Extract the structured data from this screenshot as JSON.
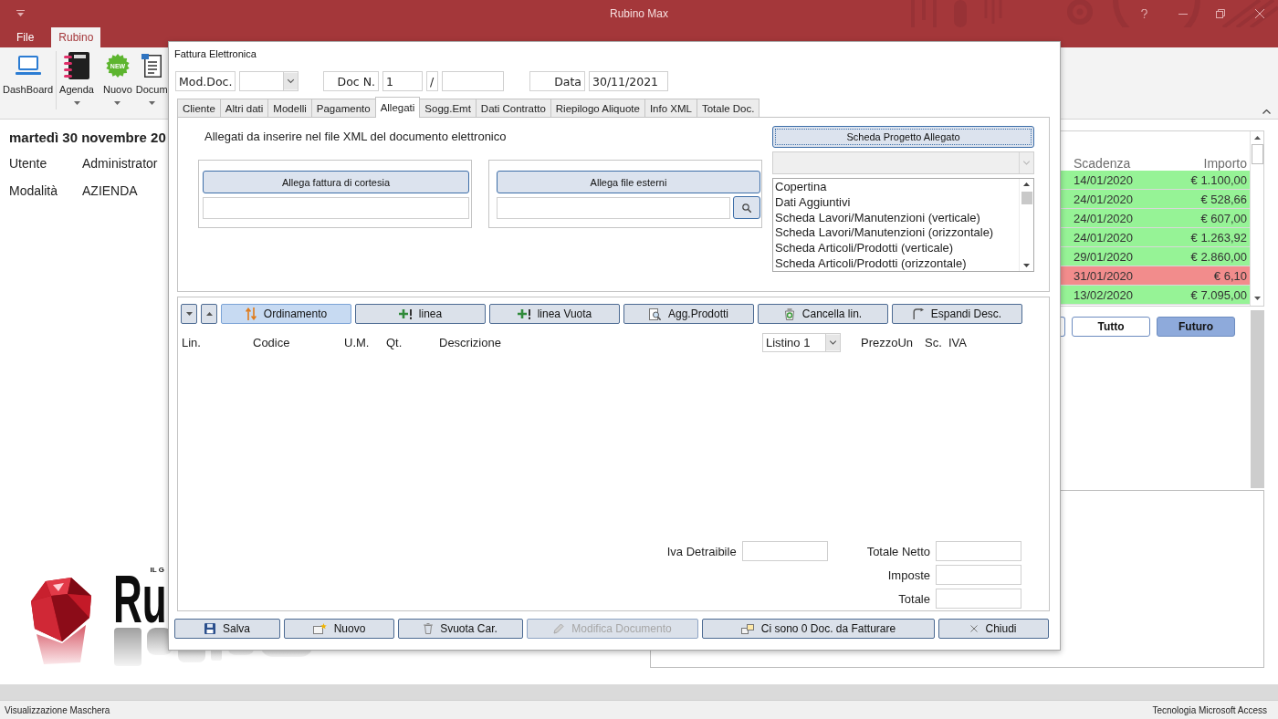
{
  "window": {
    "title": "Rubino Max"
  },
  "ribbon": {
    "tabs": [
      {
        "label": "File",
        "selected": false
      },
      {
        "label": "Rubino",
        "selected": true
      }
    ],
    "buttons": [
      {
        "label": "DashBoard",
        "dropdown": false
      },
      {
        "label": "Agenda",
        "dropdown": true
      },
      {
        "label": "Nuovo",
        "dropdown": true,
        "badge": "NEW"
      },
      {
        "label": "Docum",
        "dropdown": true
      }
    ]
  },
  "session": {
    "date": "martedì 30 novembre 20",
    "fields": [
      {
        "label": "Utente",
        "value": "Administrator"
      },
      {
        "label": "Modalità",
        "value": "AZIENDA"
      }
    ]
  },
  "logo": {
    "tagline": "IL G",
    "wordmark": "Ru"
  },
  "deadlines": {
    "columns": [
      "Scadenza",
      "Importo"
    ],
    "rows": [
      {
        "date": "14/01/2020",
        "amount": "€ 1.100,00",
        "color": "#96f396"
      },
      {
        "date": "24/01/2020",
        "amount": "€ 528,66",
        "color": "#96f396"
      },
      {
        "date": "24/01/2020",
        "amount": "€ 607,00",
        "color": "#96f396"
      },
      {
        "date": "24/01/2020",
        "amount": "€ 1.263,92",
        "color": "#96f396"
      },
      {
        "date": "29/01/2020",
        "amount": "€ 2.860,00",
        "color": "#96f396"
      },
      {
        "date": "31/01/2020",
        "amount": "€ 6,10",
        "color": "#f28c8c"
      },
      {
        "date": "13/02/2020",
        "amount": "€ 7.095,00",
        "color": "#96f396"
      }
    ],
    "filters": [
      {
        "selected": false
      },
      {
        "label": "Tutto",
        "selected": false
      },
      {
        "label": "Futuro",
        "selected": true
      }
    ]
  },
  "dialog": {
    "title": "Fattura Elettronica",
    "header": {
      "model_label": "Mod.Doc.",
      "number_label": "Doc N.",
      "number": "1",
      "separator": "/",
      "date_label": "Data",
      "date": "30/11/2021"
    },
    "tabs": [
      {
        "label": "Cliente",
        "selected": false
      },
      {
        "label": "Altri dati",
        "selected": false
      },
      {
        "label": "Modelli",
        "selected": false
      },
      {
        "label": "Pagamento",
        "selected": false
      },
      {
        "label": "Allegati",
        "selected": true
      },
      {
        "label": "Sogg.Emt",
        "selected": false
      },
      {
        "label": "Dati Contratto",
        "selected": false
      },
      {
        "label": "Riepilogo Aliquote",
        "selected": false
      },
      {
        "label": "Info XML",
        "selected": false
      },
      {
        "label": "Totale Doc.",
        "selected": false
      }
    ],
    "attachments": {
      "caption": "Allegati da inserire nel file XML del documento elettronico",
      "courtesy_button": "Allega fattura di cortesia",
      "external_button": "Allega file esterni",
      "project_button": "Scheda Progetto Allegato",
      "template_select": {
        "disabled": true
      },
      "templates": [
        "Copertina",
        "Dati Aggiuntivi",
        "Scheda Lavori/Manutenzioni (verticale)",
        "Scheda Lavori/Manutenzioni (orizzontale)",
        "Scheda Articoli/Prodotti (verticale)",
        "Scheda Articoli/Prodotti (orizzontale)"
      ]
    },
    "lines": {
      "toolbar": [
        {
          "label": "Ordinamento",
          "selected": true
        },
        {
          "label": "linea",
          "selected": false
        },
        {
          "label": "linea Vuota",
          "selected": false
        },
        {
          "label": "Agg.Prodotti",
          "selected": false
        },
        {
          "label": "Cancella lin.",
          "selected": false
        },
        {
          "label": "Espandi Desc.",
          "selected": false
        }
      ],
      "columns": [
        {
          "kind": "label",
          "text": "Lin."
        },
        {
          "kind": "label",
          "text": "Codice"
        },
        {
          "kind": "label",
          "text": "U.M."
        },
        {
          "kind": "label",
          "text": "Qt."
        },
        {
          "kind": "label",
          "text": "Descrizione"
        },
        {
          "kind": "combo",
          "text": "Listino 1"
        },
        {
          "kind": "label",
          "text": "PrezzoUn"
        },
        {
          "kind": "label",
          "text": "Sc."
        },
        {
          "kind": "label",
          "text": "IVA"
        }
      ]
    },
    "totals": {
      "left": [
        "Iva Detraibile"
      ],
      "right": [
        "Totale Netto",
        "Imposte",
        "Totale"
      ]
    },
    "buttons": [
      {
        "label": "Salva",
        "disabled": false
      },
      {
        "label": "Nuovo",
        "disabled": false
      },
      {
        "label": "Svuota Car.",
        "disabled": false
      },
      {
        "label": "Modifica Documento",
        "disabled": true
      },
      {
        "label": "Ci sono 0 Doc. da Fatturare",
        "disabled": false
      },
      {
        "label": "Chiudi",
        "disabled": false
      }
    ]
  },
  "status_bar": {
    "left": "Visualizzazione Maschera",
    "right": "Tecnologia Microsoft Access"
  }
}
